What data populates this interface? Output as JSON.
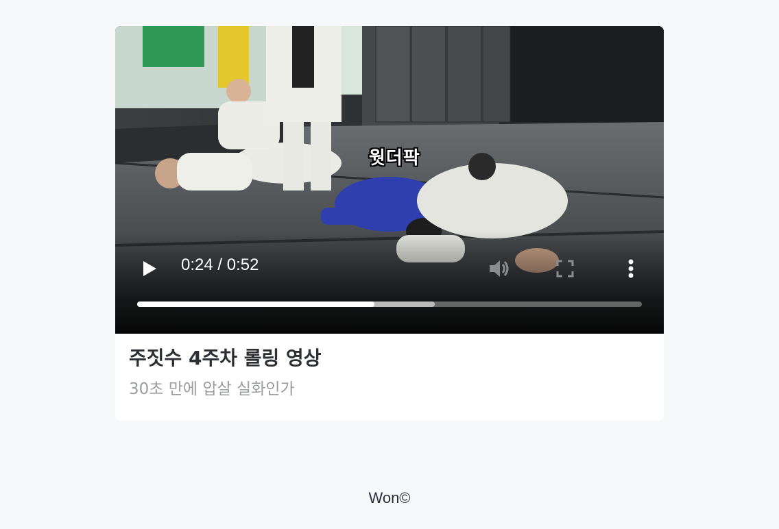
{
  "video": {
    "caption": "웟더팍",
    "current_time": "0:24",
    "duration": "0:52",
    "time_display": "0:24 / 0:52",
    "played_fraction": 0.47,
    "buffered_fraction": 0.59,
    "icons": {
      "play": "play-icon",
      "volume": "volume-icon",
      "fullscreen": "fullscreen-icon",
      "more": "more-vertical-icon"
    }
  },
  "post": {
    "title": "주짓수 4주차 롤링 영상",
    "subtitle": "30초 만에 압살 실화인가"
  },
  "footer": {
    "text": "Won©"
  },
  "colors": {
    "page_background": "#f7f8fa",
    "card_background": "#ffffff",
    "title": "#2c2e33",
    "subtitle": "#9a9ca0"
  }
}
